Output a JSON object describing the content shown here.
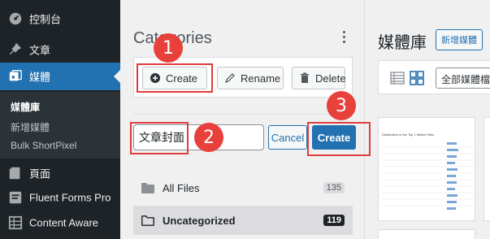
{
  "sidebar": {
    "items": [
      {
        "label": "控制台",
        "icon": "dashboard-icon"
      },
      {
        "label": "文章",
        "icon": "pin-icon"
      },
      {
        "label": "媒體",
        "icon": "media-icon"
      },
      {
        "label": "頁面",
        "icon": "page-icon"
      },
      {
        "label": "Fluent Forms Pro",
        "icon": "forms-icon"
      },
      {
        "label": "Content Aware",
        "icon": "grid-icon"
      }
    ],
    "submenu": [
      "媒體庫",
      "新增媒體",
      "Bulk ShortPixel"
    ],
    "active_color": "#2271b1"
  },
  "categories": {
    "title": "Categories",
    "buttons": {
      "create": "Create",
      "rename": "Rename",
      "delete": "Delete"
    },
    "new_folder_value": "文章封面",
    "cancel": "Cancel",
    "create_confirm": "Create",
    "folders": [
      {
        "label": "All Files",
        "count": "135"
      },
      {
        "label": "Uncategorized",
        "count": "119"
      }
    ]
  },
  "media": {
    "title": "媒體庫",
    "add_new": "新增媒體",
    "filter": "全部媒體檔",
    "thumb_caption": "Distribution in the Top 1 Million Sites"
  },
  "callouts": [
    "1",
    "2",
    "3"
  ],
  "colors": {
    "callout": "#e03c3c",
    "primary": "#2271b1"
  }
}
